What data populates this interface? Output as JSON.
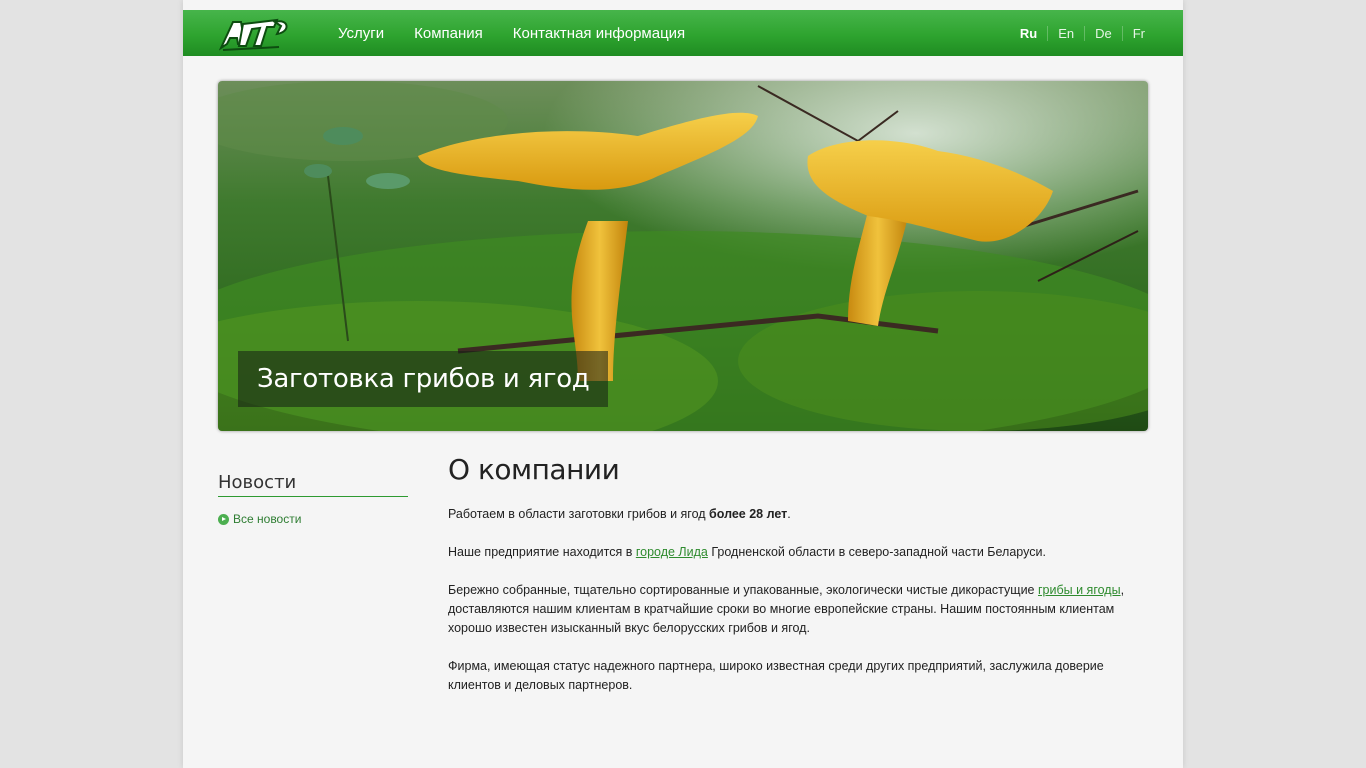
{
  "header": {
    "logo_text": "АП",
    "nav": [
      "Услуги",
      "Компания",
      "Контактная информация"
    ],
    "languages": [
      "Ru",
      "En",
      "De",
      "Fr"
    ],
    "active_language": "Ru"
  },
  "hero": {
    "caption": "Заготовка грибов и ягод"
  },
  "sidebar": {
    "title": "Новости",
    "link": "Все новости"
  },
  "main": {
    "title": "О компании",
    "p1_text": "Работаем в области заготовки грибов и ягод ",
    "p1_bold": "более 28 лет",
    "p1_end": ".",
    "p2_start": "Наше предприятие находится в ",
    "p2_link": "городе Лида",
    "p2_end": " Гродненской области в северо-западной части Беларуси.",
    "p3_start": "Бережно собранные, тщательно сортированные и упакованные, экологически чистые дикорастущие ",
    "p3_link": "грибы и ягоды",
    "p3_end": ", доставляются нашим клиентам в кратчайшие сроки во многие европейские страны. Нашим постоянным клиентам хорошо известен изысканный вкус белорусских грибов и ягод.",
    "p4": "Фирма, имеющая статус надежного партнера, широко известная среди других предприятий, заслужила доверие клиентов и деловых партнеров."
  },
  "colors": {
    "header_green": "#2ea42f",
    "link_green": "#2e8b2e",
    "mushroom_yellow": "#e8b320"
  }
}
